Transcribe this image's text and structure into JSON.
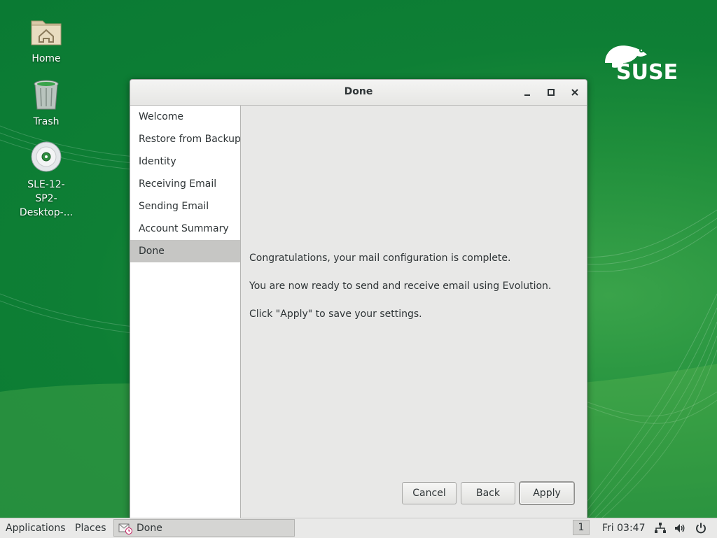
{
  "desktop": {
    "icons": [
      {
        "label": "Home"
      },
      {
        "label": "Trash"
      },
      {
        "label": "SLE-12-\nSP2-\nDesktop-..."
      }
    ]
  },
  "window": {
    "title": "Done",
    "sidebar": {
      "items": [
        {
          "label": "Welcome"
        },
        {
          "label": "Restore from Backup"
        },
        {
          "label": "Identity"
        },
        {
          "label": "Receiving Email"
        },
        {
          "label": "Sending Email"
        },
        {
          "label": "Account Summary"
        },
        {
          "label": "Done"
        }
      ],
      "active_index": 6
    },
    "messages": {
      "line1": "Congratulations, your mail configuration is complete.",
      "line2": "You are now ready to send and receive email using Evolution.",
      "line3": "Click \"Apply\" to save your settings."
    },
    "buttons": {
      "cancel": "Cancel",
      "back": "Back",
      "apply": "Apply"
    }
  },
  "taskbar": {
    "applications": "Applications",
    "places": "Places",
    "task_label": "Done",
    "workspace": "1",
    "clock": "Fri 03:47",
    "tray_icons": [
      "network-icon",
      "volume-icon",
      "power-icon"
    ]
  },
  "colors": {
    "desktop_green": "#0e7f35",
    "selection_gray": "#c6c6c4"
  }
}
